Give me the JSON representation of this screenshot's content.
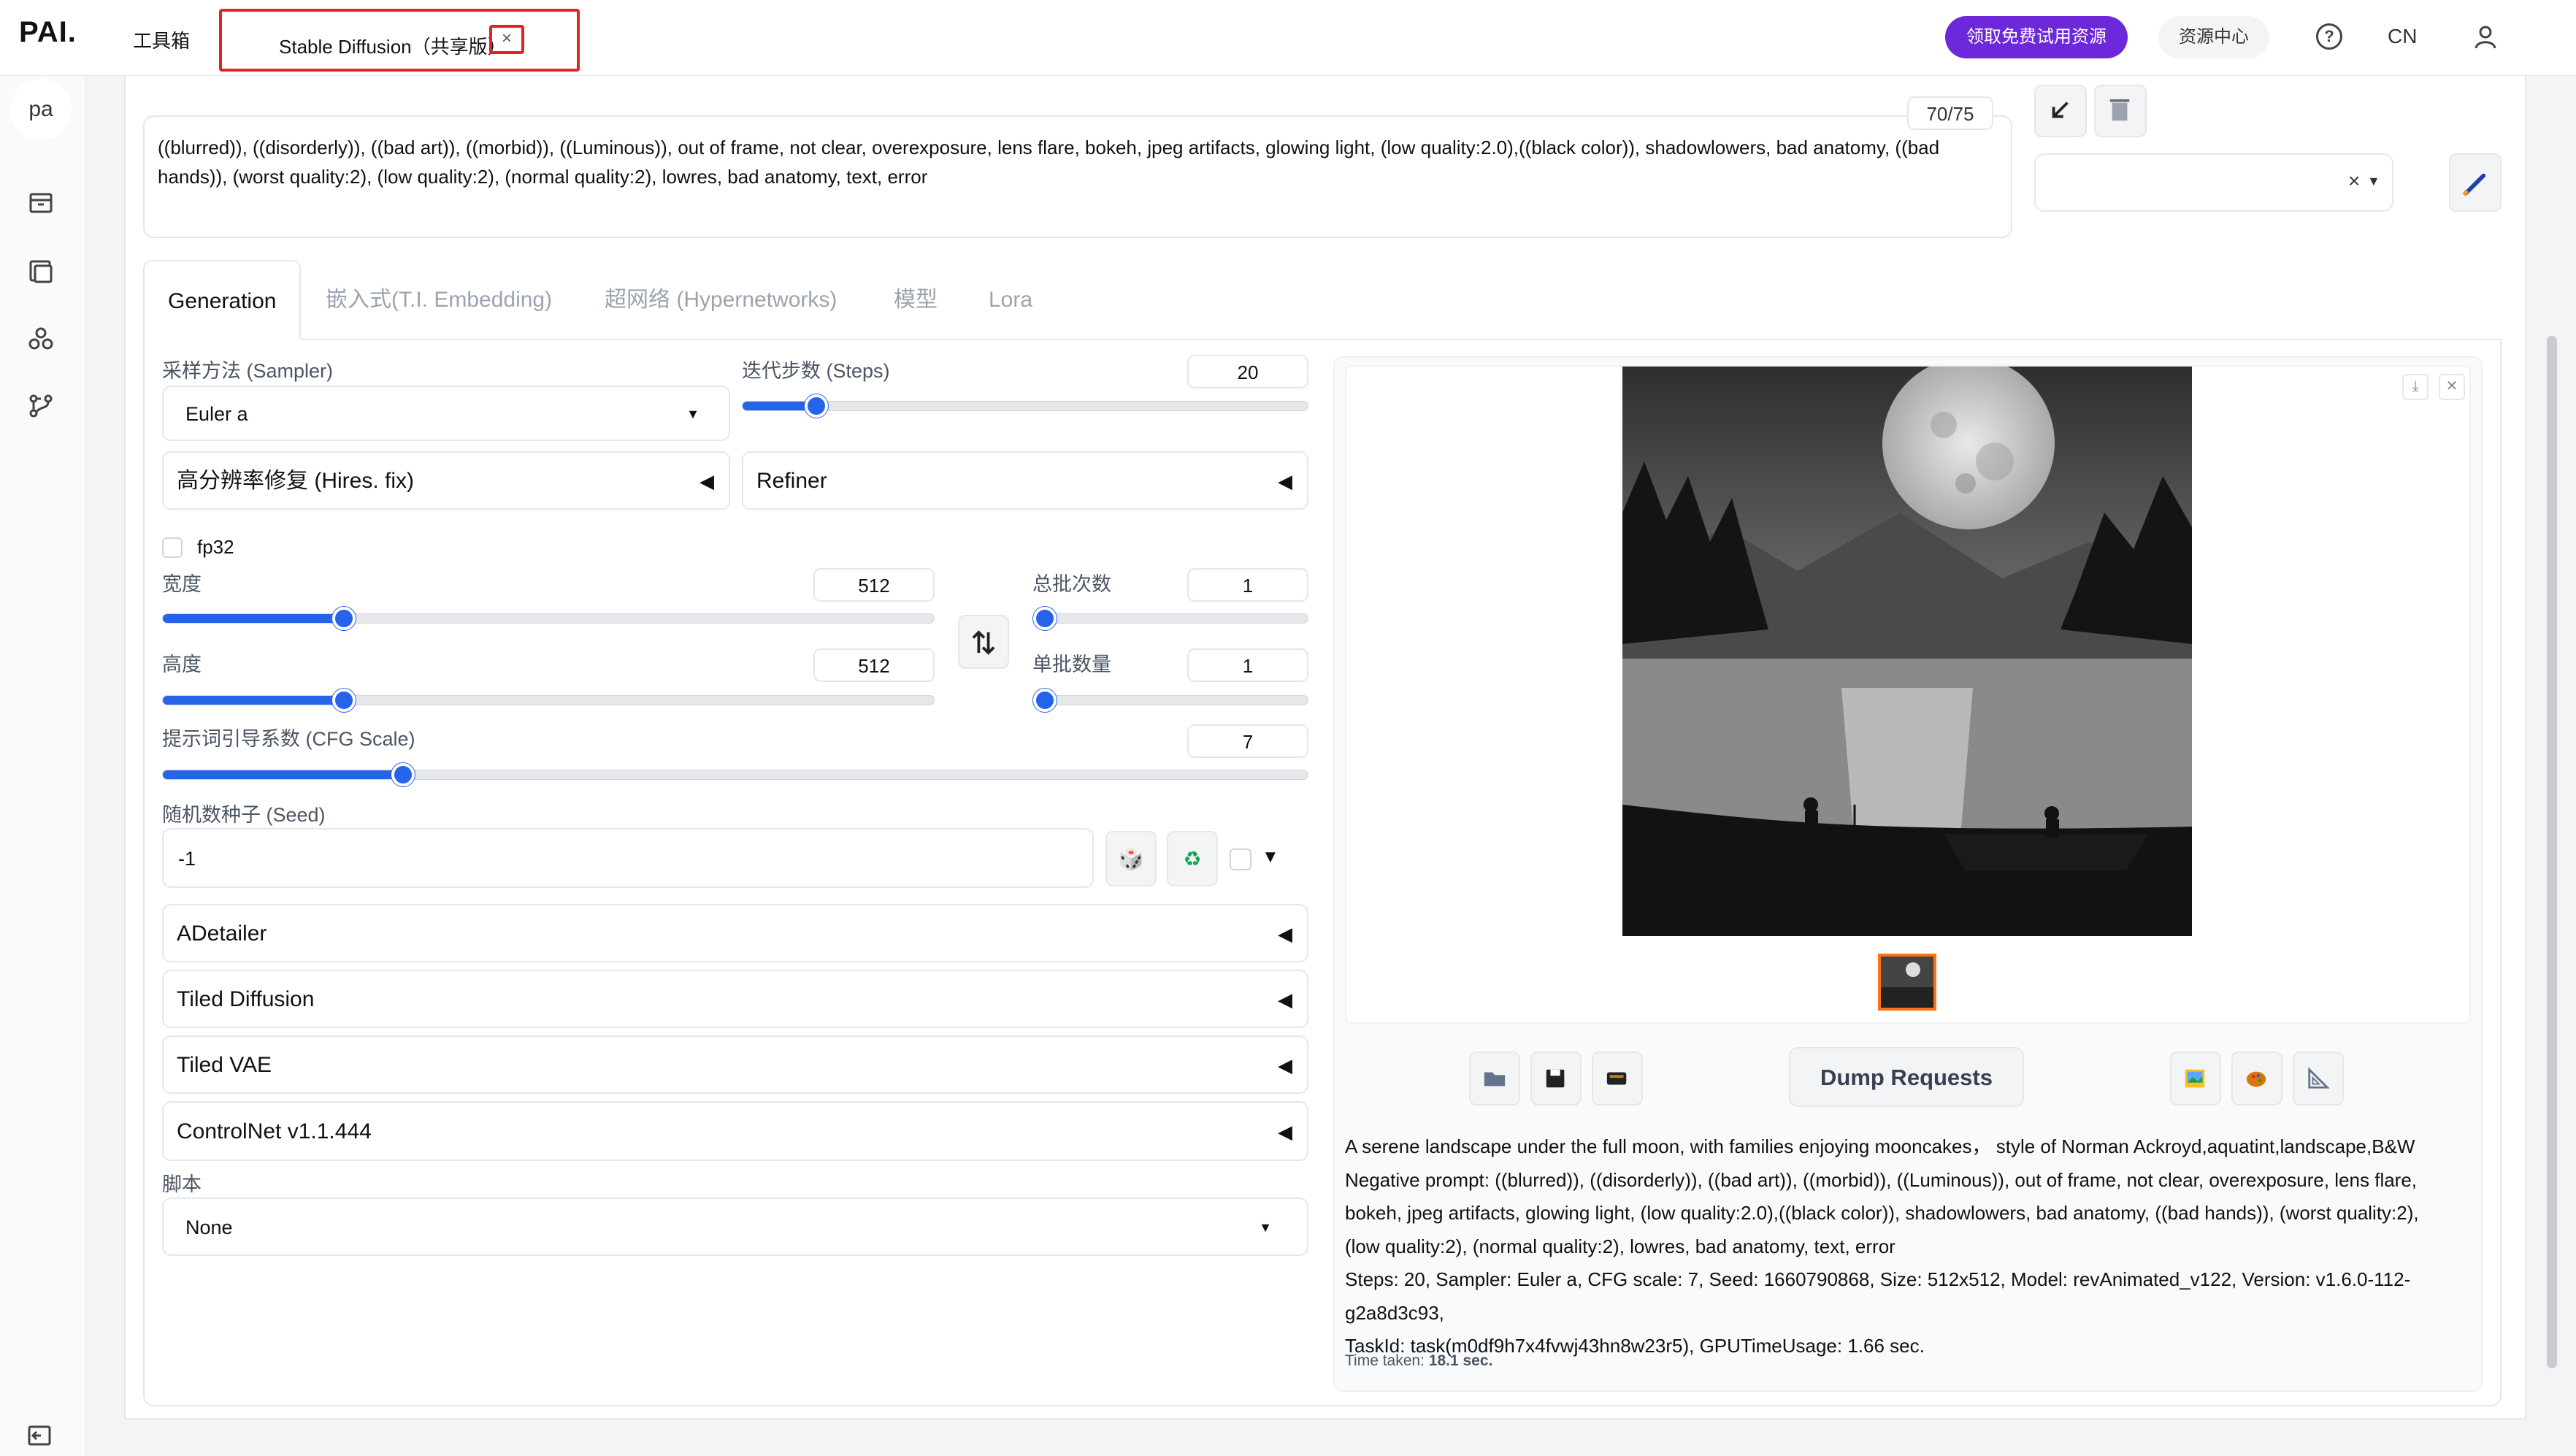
{
  "app": {
    "logo": "PAI.",
    "toolbox_tab": "工具箱",
    "active_tab": "Stable Diffusion（共享版）",
    "active_tab_close": "×",
    "trial_button": "领取免费试用资源",
    "resource_center": "资源中心",
    "help": "?",
    "language": "CN"
  },
  "leftrail": {
    "avatar": "pa",
    "icons": [
      "box-icon",
      "gallery-icon",
      "cluster-icon",
      "pipeline-icon"
    ],
    "bottom_icon": "collapse-icon"
  },
  "prompt": {
    "negative_text": "((blurred)), ((disorderly)), ((bad art)), ((morbid)), ((Luminous)), out of frame, not clear, overexposure, lens flare, bokeh, jpeg artifacts, glowing light, (low quality:2.0),((black color)), shadowlowers, bad anatomy, ((bad hands)), (worst quality:2), (low quality:2), (normal quality:2), lowres, bad anatomy, text, error",
    "token_count": "70/75",
    "style_clear": "×"
  },
  "tabs": [
    "Generation",
    "嵌入式(T.I. Embedding)",
    "超网络 (Hypernetworks)",
    "模型",
    "Lora"
  ],
  "generation": {
    "sampler_label": "采样方法 (Sampler)",
    "sampler_value": "Euler a",
    "steps_label": "迭代步数 (Steps)",
    "steps_value": "20",
    "steps_fraction": 0.13,
    "hires_label": "高分辨率修复 (Hires. fix)",
    "refiner_label": "Refiner",
    "fp32_label": "fp32",
    "width_label": "宽度",
    "width_value": "512",
    "width_fraction": 0.235,
    "height_label": "高度",
    "height_value": "512",
    "height_fraction": 0.235,
    "batch_count_label": "总批次数",
    "batch_count_value": "1",
    "batch_count_fraction": 0.0,
    "batch_size_label": "单批数量",
    "batch_size_value": "1",
    "batch_size_fraction": 0.0,
    "cfg_label": "提示词引导系数 (CFG Scale)",
    "cfg_value": "7",
    "cfg_fraction": 0.21,
    "seed_label": "随机数种子 (Seed)",
    "seed_value": "-1",
    "accordions": [
      "ADetailer",
      "Tiled Diffusion",
      "Tiled VAE",
      "ControlNet v1.1.444"
    ],
    "script_label": "脚本",
    "script_value": "None"
  },
  "output": {
    "dump_button": "Dump Requests",
    "tool_icons_left": [
      "folder-icon",
      "save-icon",
      "zip-icon"
    ],
    "tool_icons_right": [
      "image-icon",
      "palette-icon",
      "ruler-icon"
    ],
    "info_lines": [
      "A serene landscape under the full moon, with families enjoying mooncakes，  style of Norman Ackroyd,aquatint,landscape,B&W",
      "Negative prompt: ((blurred)), ((disorderly)), ((bad art)), ((morbid)), ((Luminous)), out of frame, not clear, overexposure, lens flare,",
      "bokeh, jpeg artifacts, glowing light, (low quality:2.0),((black color)), shadowlowers, bad anatomy, ((bad hands)), (worst quality:2),",
      "(low quality:2), (normal quality:2), lowres, bad anatomy, text, error",
      "Steps: 20, Sampler: Euler a, CFG scale: 7, Seed: 1660790868, Size: 512x512, Model: revAnimated_v122, Version: v1.6.0-112-g2a8d3c93,",
      "TaskId: task(m0df9h7x4fvwj43hn8w23r5), GPUTimeUsage: 1.66 sec."
    ],
    "time_label": "Time taken:",
    "time_value": "18.1 sec."
  }
}
